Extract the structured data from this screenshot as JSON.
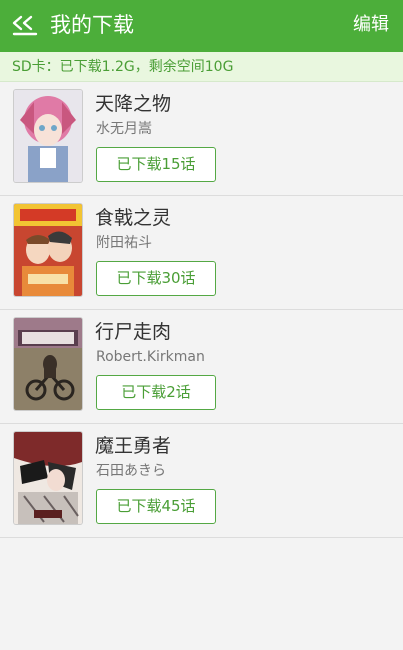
{
  "header": {
    "title": "我的下载",
    "edit_label": "编辑",
    "back_icon": "back-arrow-icon"
  },
  "storage": {
    "text": "SD卡：已下载1.2G，剩余空间10G"
  },
  "items": [
    {
      "title": "天降之物",
      "author": "水无月嵩",
      "download_label": "已下载15话"
    },
    {
      "title": "食戟之灵",
      "author": "附田祐斗",
      "download_label": "已下载30话"
    },
    {
      "title": "行尸走肉",
      "author": "Robert.Kirkman",
      "download_label": "已下载2话"
    },
    {
      "title": "魔王勇者",
      "author": "石田あきら",
      "download_label": "已下载45话"
    }
  ],
  "colors": {
    "accent": "#4cae3a",
    "accent_text": "#4a9e36",
    "banner_bg": "#e9f7df",
    "background": "#f3f3f3"
  }
}
